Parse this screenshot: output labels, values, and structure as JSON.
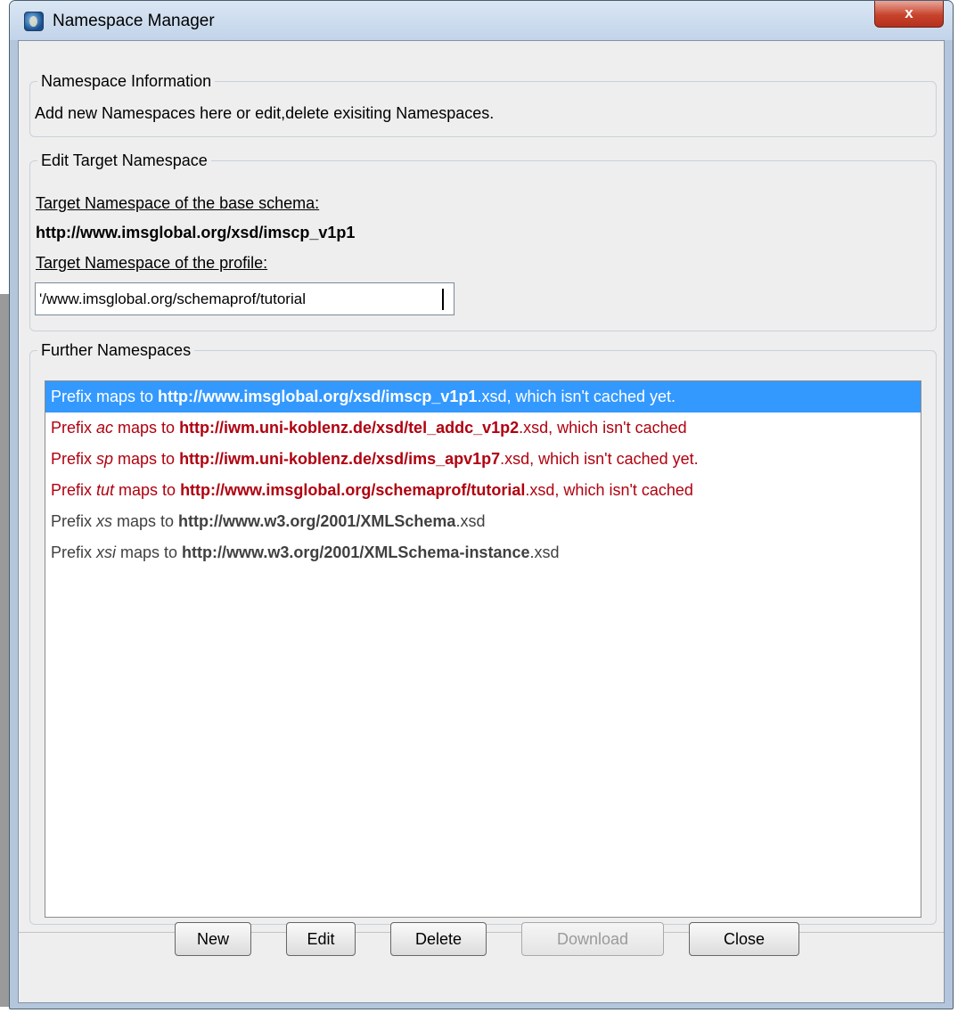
{
  "window": {
    "title": "Namespace Manager",
    "close_label": "x"
  },
  "info": {
    "legend": "Namespace Information",
    "text": "Add new Namespaces here or edit,delete exisiting Namespaces."
  },
  "target": {
    "legend": "Edit Target Namespace",
    "base_label": "Target Namespace of the base schema:",
    "base_value": "http://www.imsglobal.org/xsd/imscp_v1p1",
    "profile_label": "Target Namespace of the profile:",
    "profile_value": "'/www.imsglobal.org/schemaprof/tutorial"
  },
  "further": {
    "legend": "Further Namespaces",
    "items": [
      {
        "p1": "Prefix ",
        "prefix": "",
        "p2": "maps to ",
        "url": "http://www.imsglobal.org/xsd/imscp_v1p1",
        "tail": ".xsd, which isn't cached yet."
      },
      {
        "p1": "Prefix ",
        "prefix": "ac",
        "p2": " maps to ",
        "url": "http://iwm.uni-koblenz.de/xsd/tel_addc_v1p2",
        "tail": ".xsd, which isn't cached"
      },
      {
        "p1": "Prefix ",
        "prefix": "sp",
        "p2": " maps to ",
        "url": "http://iwm.uni-koblenz.de/xsd/ims_apv1p7",
        "tail": ".xsd, which isn't cached yet."
      },
      {
        "p1": "Prefix ",
        "prefix": "tut",
        "p2": " maps to ",
        "url": "http://www.imsglobal.org/schemaprof/tutorial",
        "tail": ".xsd, which isn't cached"
      },
      {
        "p1": "Prefix ",
        "prefix": "xs",
        "p2": " maps to ",
        "url": "http://www.w3.org/2001/XMLSchema",
        "tail": ".xsd"
      },
      {
        "p1": "Prefix ",
        "prefix": "xsi",
        "p2": " maps to ",
        "url": "http://www.w3.org/2001/XMLSchema-instance",
        "tail": ".xsd"
      }
    ]
  },
  "buttons": {
    "new": "New",
    "edit": "Edit",
    "delete": "Delete",
    "download": "Download",
    "close": "Close"
  },
  "colors": {
    "selection": "#3399ff",
    "uncached": "#b0000f",
    "cached": "#404040"
  }
}
